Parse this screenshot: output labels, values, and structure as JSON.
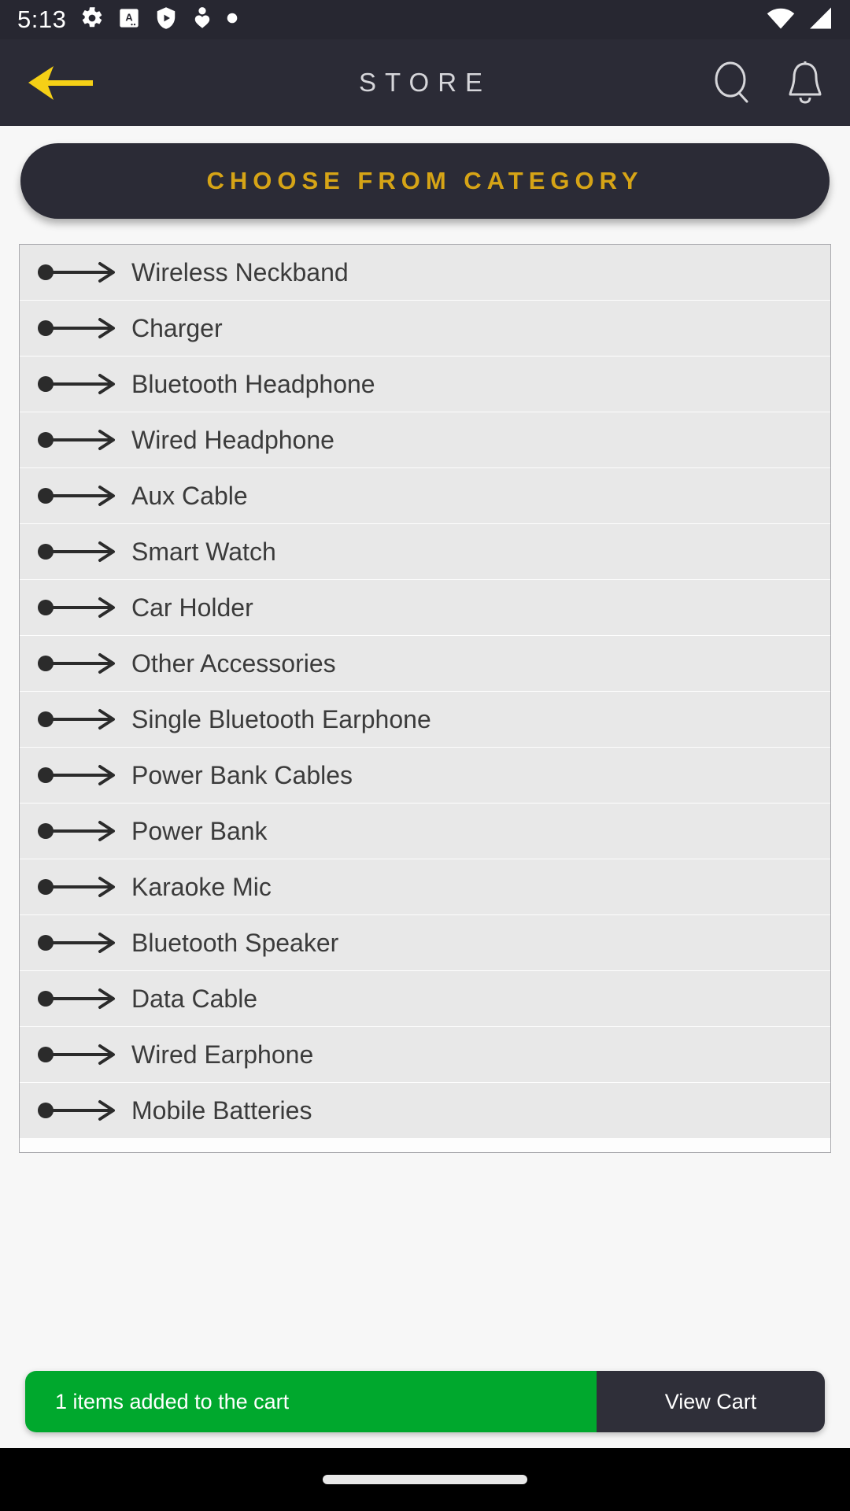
{
  "statusbar": {
    "time": "5:13",
    "left_icons": [
      "gear-icon",
      "text-badge-icon",
      "play-shield-icon",
      "person-heart-icon",
      "dot-icon"
    ],
    "right_icons": [
      "wifi-icon",
      "signal-icon"
    ]
  },
  "appbar": {
    "back_icon": "back-arrow-icon",
    "title": "STORE",
    "search_icon": "search-icon",
    "notification_icon": "bell-icon"
  },
  "banner": {
    "label": "CHOOSE FROM CATEGORY"
  },
  "categories": [
    {
      "label": "Wireless Neckband"
    },
    {
      "label": "Charger"
    },
    {
      "label": "Bluetooth Headphone"
    },
    {
      "label": "Wired Headphone"
    },
    {
      "label": "Aux Cable"
    },
    {
      "label": "Smart Watch"
    },
    {
      "label": "Car Holder"
    },
    {
      "label": "Other Accessories"
    },
    {
      "label": "Single Bluetooth Earphone"
    },
    {
      "label": "Power Bank Cables"
    },
    {
      "label": "Power Bank"
    },
    {
      "label": "Karaoke Mic"
    },
    {
      "label": "Bluetooth Speaker"
    },
    {
      "label": "Data Cable"
    },
    {
      "label": "Wired Earphone"
    },
    {
      "label": "Mobile Batteries"
    }
  ],
  "snackbar": {
    "message": "1 items added to the cart",
    "action_label": "View Cart"
  },
  "navbar": {
    "home_pill": "home-indicator"
  },
  "colors": {
    "appbar_bg": "#2b2b36",
    "statusbar_bg": "#272731",
    "accent_gold": "#d6a416",
    "back_arrow": "#f5d016",
    "row_bg": "#e8e8e8",
    "snack_green": "#00a82d",
    "snack_action_bg": "#2f2f39",
    "page_bg": "#f7f7f7"
  }
}
